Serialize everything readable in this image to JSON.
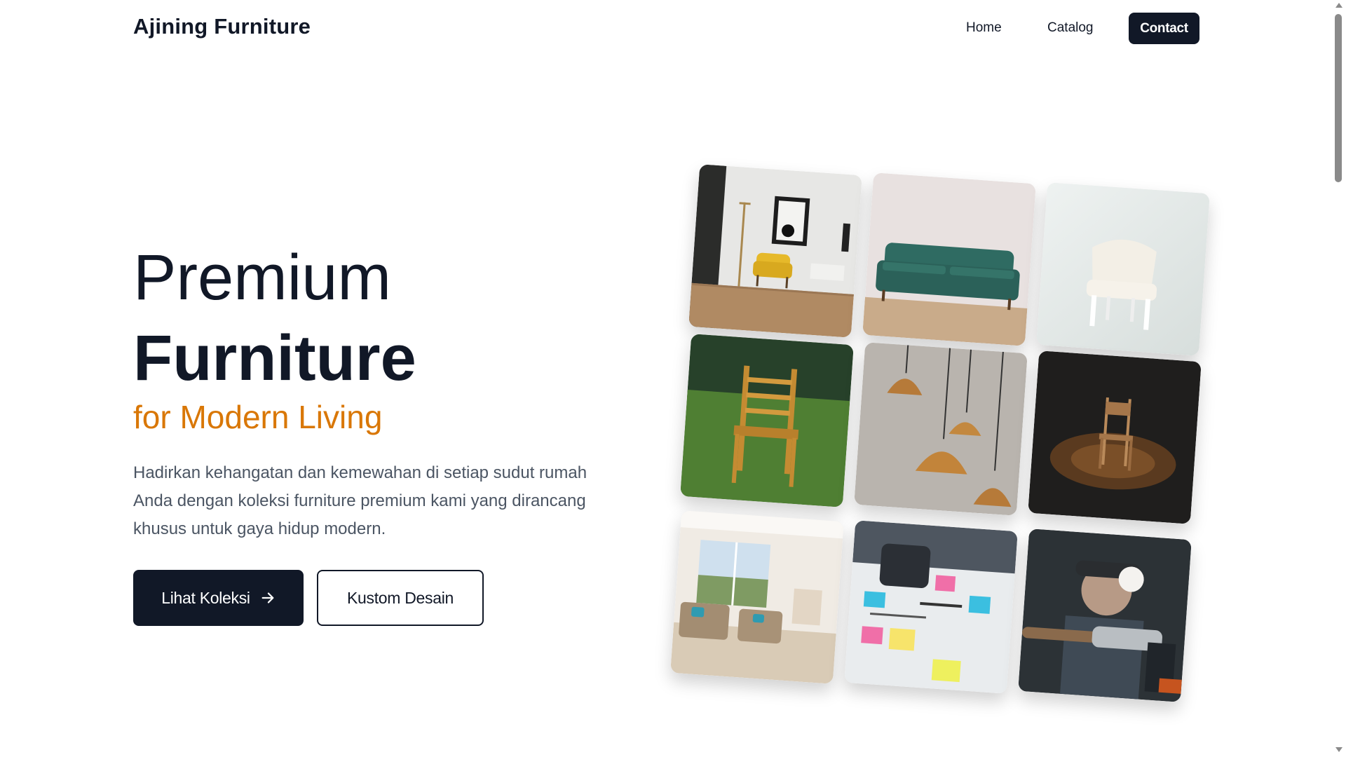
{
  "brand": "Ajining Furniture",
  "nav": {
    "home": "Home",
    "catalog": "Catalog",
    "contact": "Contact"
  },
  "hero": {
    "line1": "Premium",
    "line2": "Furniture",
    "line3": "for Modern Living",
    "description": "Hadirkan kehangatan dan kemewahan di setiap sudut rumah Anda dengan koleksi furniture premium kami yang dirancang khusus untuk gaya hidup modern.",
    "primary_button": "Lihat Koleksi",
    "secondary_button": "Kustom Desain"
  },
  "colors": {
    "primary": "#111827",
    "accent": "#d97706",
    "body_text": "#4b5563"
  },
  "icons": {
    "primary_button_icon": "arrow-right-icon"
  }
}
